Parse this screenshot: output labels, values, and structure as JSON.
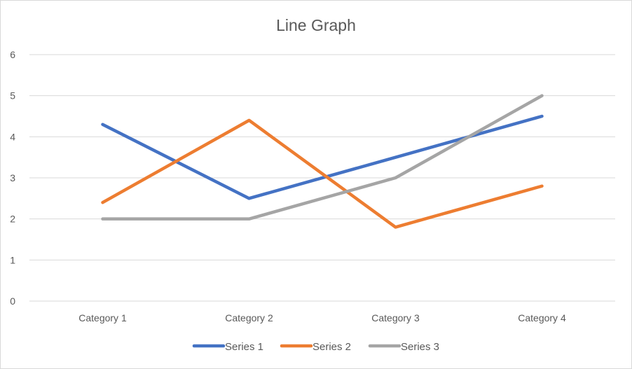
{
  "chart_data": {
    "type": "line",
    "title": "Line Graph",
    "xlabel": "",
    "ylabel": "",
    "categories": [
      "Category 1",
      "Category 2",
      "Category 3",
      "Category 4"
    ],
    "ylim": [
      0,
      6
    ],
    "yticks": [
      0,
      1,
      2,
      3,
      4,
      5,
      6
    ],
    "grid": true,
    "legend_position": "bottom",
    "series": [
      {
        "name": "Series 1",
        "color": "#4472c4",
        "values": [
          4.3,
          2.5,
          3.5,
          4.5
        ]
      },
      {
        "name": "Series 2",
        "color": "#ed7d31",
        "values": [
          2.4,
          4.4,
          1.8,
          2.8
        ]
      },
      {
        "name": "Series 3",
        "color": "#a5a5a5",
        "values": [
          2,
          2,
          3,
          5
        ]
      }
    ]
  }
}
